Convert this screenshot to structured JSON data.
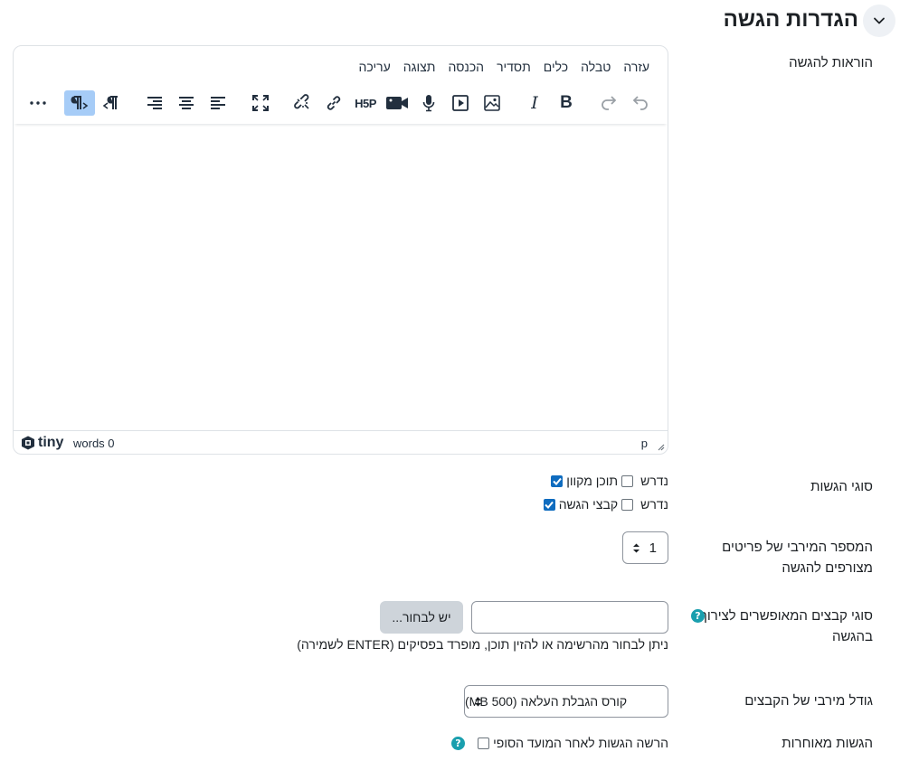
{
  "section": {
    "title": "הגדרות הגשה"
  },
  "instructions": {
    "label": "הוראות להגשה"
  },
  "editor": {
    "menu": [
      "עריכה",
      "תצוגה",
      "הכנסה",
      "תסדיר",
      "כלים",
      "טבלה",
      "עזרה"
    ],
    "toolbar_icons": [
      "undo-icon",
      "redo-icon",
      "bold-icon",
      "italic-icon",
      "image-icon",
      "media-icon",
      "microphone-icon",
      "video-camera-icon",
      "h5p-icon",
      "link-icon",
      "unlink-icon",
      "fullscreen-icon",
      "align-left-icon",
      "align-center-icon",
      "align-right-icon",
      "rtl-icon",
      "ltr-icon",
      "more-icon"
    ],
    "bold_glyph": "B",
    "italic_glyph": "I",
    "h5p_text": "H5P",
    "tiny_logo_text": "tiny",
    "word_count": "words 0",
    "path": "p",
    "active_color": "#a6ccf7"
  },
  "submission_types": {
    "label": "סוגי הגשות",
    "options": [
      {
        "label": "תוכן מקוון",
        "checked": true,
        "required_label": "נדרש",
        "required": false
      },
      {
        "label": "קבצי הגשה",
        "checked": true,
        "required_label": "נדרש",
        "required": false
      }
    ]
  },
  "max_files": {
    "label": "המספר המירבי של פריטים מצורפים להגשה",
    "value": "1"
  },
  "file_types": {
    "label": "סוגי קבצים המאופשרים לצירוף בהגשה",
    "input_value": "",
    "choose_button": "יש לבחור...",
    "help_text": "ניתן לבחור מהרשימה או להזין תוכן, מופרד בפסיקים (ENTER לשמירה)"
  },
  "max_size": {
    "label": "גודל מירבי של הקבצים",
    "value": "קורס הגבלת העלאה (500 MB)"
  },
  "late": {
    "label": "הגשות מאוחרות",
    "checkbox_label": "הרשה הגשות לאחר המועד הסופי",
    "checked": false
  },
  "colors": {
    "checkbox": "#0f6cbf",
    "help": "#1a9fae",
    "button_grey": "#ced4da"
  }
}
